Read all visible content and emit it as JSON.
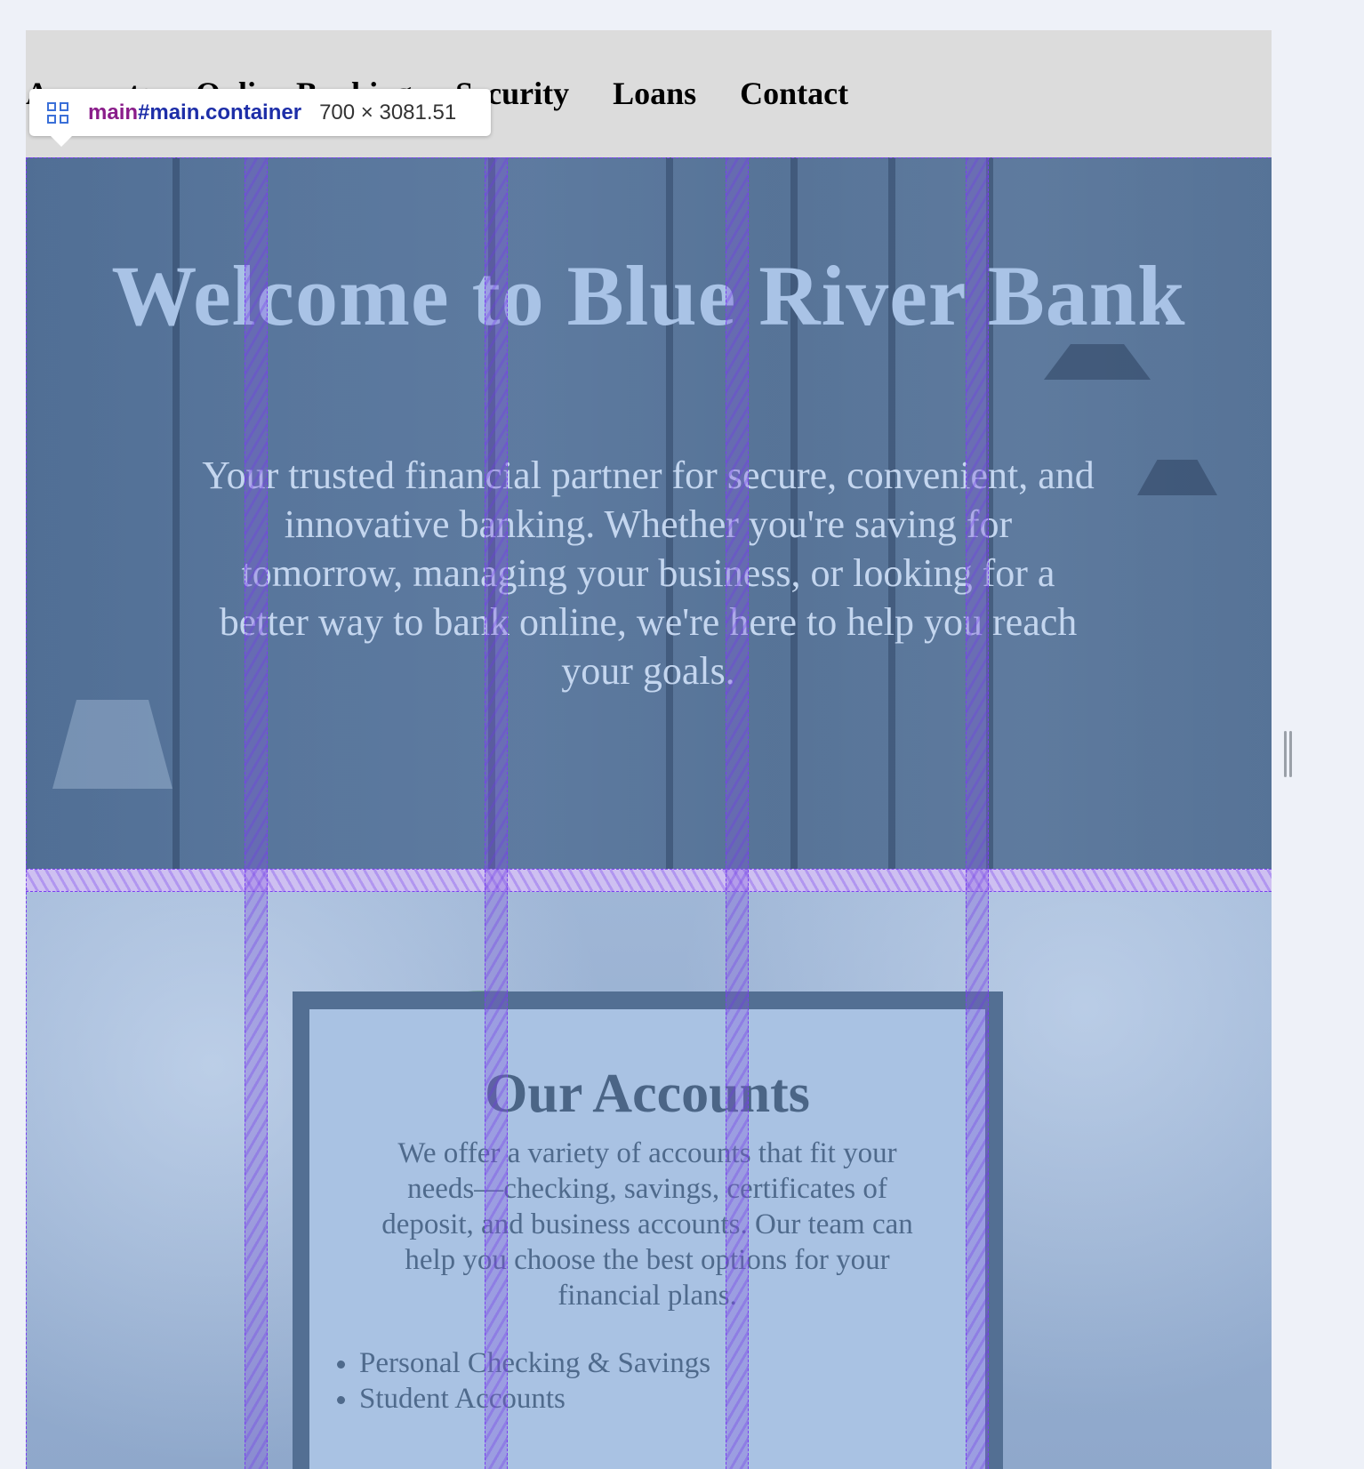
{
  "nav": {
    "items": [
      "Accounts",
      "Online Banking",
      "Security",
      "Loans",
      "Contact"
    ]
  },
  "hero": {
    "title": "Welcome to Blue River Bank",
    "text": "Your trusted financial partner for secure, convenient, and innovative banking. Whether you're saving for tomorrow, managing your business, or looking for a better way to bank online, we're here to help you reach your goals."
  },
  "accounts": {
    "title": "Our Accounts",
    "text": "We offer a variety of accounts that fit your needs—checking, savings, certificates of deposit, and business accounts. Our team can help you choose the best options for your financial plans.",
    "list": [
      "Personal Checking & Savings",
      "Student Accounts"
    ]
  },
  "devtools_tooltip": {
    "tag": "main",
    "selector": "#main.container",
    "dimensions": "700 × 3081.51"
  },
  "colors": {
    "grid_overlay": "#7a3ff0",
    "hero_title": "#a9c3e6",
    "card_border": "#536f93",
    "card_bg": "#a9c2e3"
  }
}
